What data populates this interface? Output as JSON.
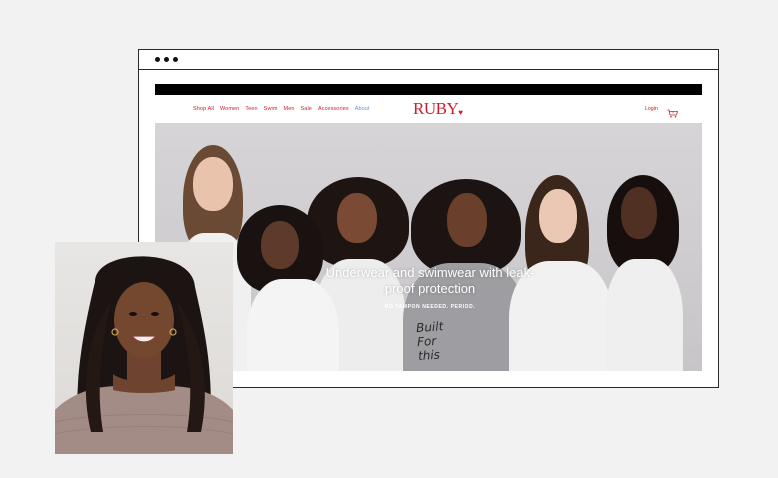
{
  "browser": {
    "dots": [
      "dot",
      "dot",
      "dot"
    ]
  },
  "site": {
    "nav": [
      {
        "label": "Shop All",
        "active": false
      },
      {
        "label": "Women",
        "active": false
      },
      {
        "label": "Teen",
        "active": false
      },
      {
        "label": "Swim",
        "active": false
      },
      {
        "label": "Men",
        "active": false
      },
      {
        "label": "Sale",
        "active": false
      },
      {
        "label": "Accessories",
        "active": false
      },
      {
        "label": "About",
        "active": true
      }
    ],
    "logo": "RUBY",
    "login": "Login",
    "cart_count": "0",
    "cart_icon": "cart-icon",
    "hero": {
      "title": "Underwear and swimwear with leak-proof protection",
      "subtitle": "NO TAMPON NEEDED. PERIOD.",
      "shirt_text_1": "Built",
      "shirt_text_2": "For",
      "shirt_text_3": "this"
    }
  },
  "colors": {
    "brand_red": "#d01c2b",
    "nav_active": "#5a9bd5",
    "background": "#f2f2f2",
    "frame": "#2a2a2a"
  }
}
